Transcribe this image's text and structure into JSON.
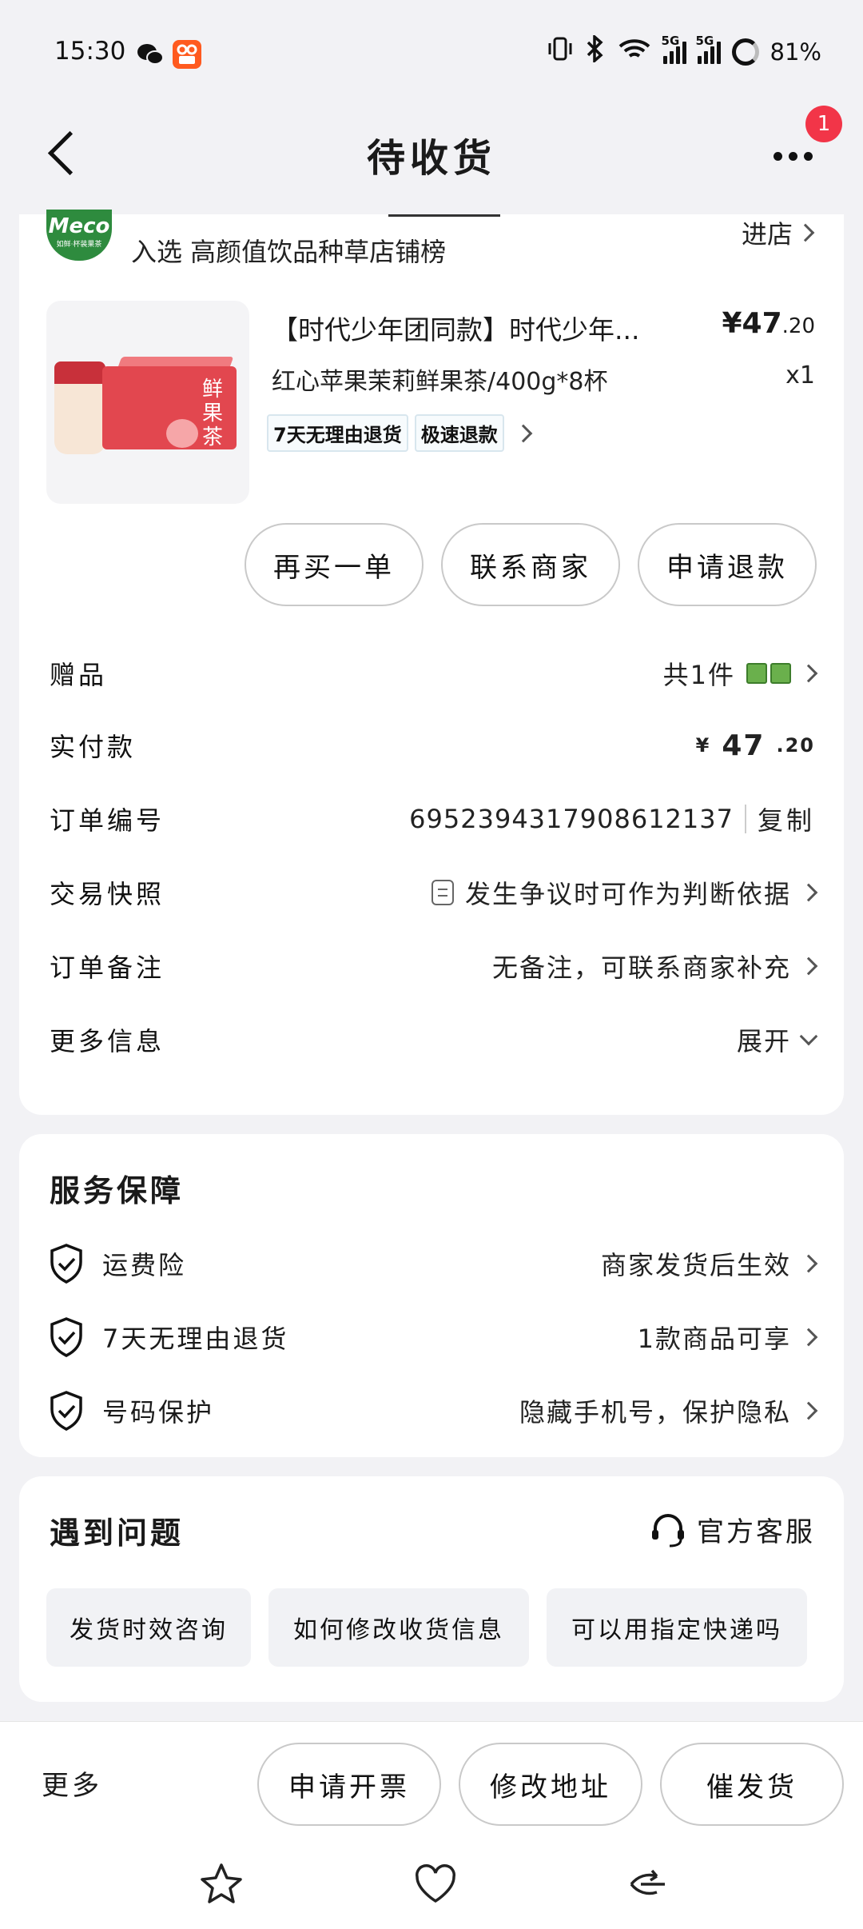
{
  "status_bar": {
    "time": "15:30",
    "battery": "81%",
    "signal1": "5G",
    "signal2": "5G"
  },
  "nav": {
    "title": "待收货",
    "badge_count": "1"
  },
  "shop": {
    "logo_text": "Meco",
    "logo_sub": "如鲜·杯装果茶",
    "tag": "入选 高颜值饮品种草店铺榜",
    "enter_label": "进店"
  },
  "product": {
    "title": "【时代少年团同款】时代少年...",
    "price_main": "¥47",
    "price_decimal": ".20",
    "spec": "红心苹果茉莉鲜果茶/400g*8杯",
    "quantity": "x1",
    "image_text": "鲜果茶",
    "tags": [
      "7天无理由退货",
      "极速退款"
    ]
  },
  "actions": [
    "再买一单",
    "联系商家",
    "申请退款"
  ],
  "details": {
    "gift": {
      "label": "赠品",
      "value": "共1件"
    },
    "paid": {
      "label": "实付款",
      "currency": "¥",
      "main": "47",
      "decimal": ".20"
    },
    "order_no": {
      "label": "订单编号",
      "value": "6952394317908612137",
      "copy": "复制"
    },
    "snapshot": {
      "label": "交易快照",
      "value": "发生争议时可作为判断依据"
    },
    "remark": {
      "label": "订单备注",
      "value": "无备注，可联系商家补充"
    },
    "more": {
      "label": "更多信息",
      "value": "展开"
    }
  },
  "service": {
    "title": "服务保障",
    "rows": [
      {
        "label": "运费险",
        "value": "商家发货后生效"
      },
      {
        "label": "7天无理由退货",
        "value": "1款商品可享"
      },
      {
        "label": "号码保护",
        "value": "隐藏手机号，保护隐私"
      }
    ]
  },
  "problem": {
    "title": "遇到问题",
    "service_label": "官方客服",
    "chips": [
      "发货时效咨询",
      "如何修改收货信息",
      "可以用指定快递吗"
    ]
  },
  "bottom": {
    "more_label": "更多",
    "actions": [
      "申请开票",
      "修改地址",
      "催发货"
    ]
  },
  "colors": {
    "badge": "#f23548",
    "brand_green": "#2e8b3e",
    "background": "#f2f2f5"
  }
}
